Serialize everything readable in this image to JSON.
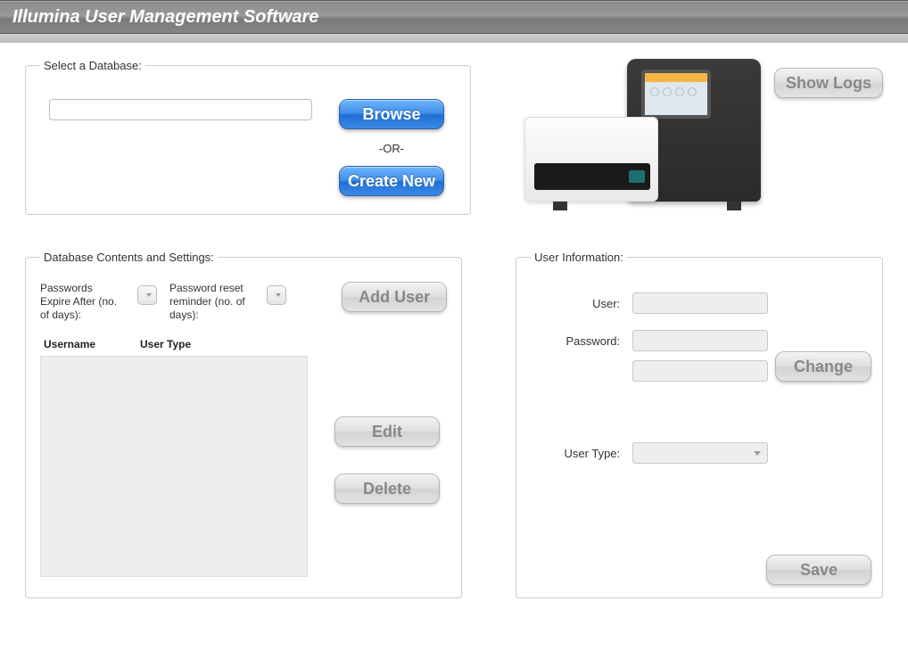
{
  "app": {
    "title": "Illumina User Management Software"
  },
  "selectDb": {
    "legend": "Select a Database:",
    "path": "",
    "browse": "Browse",
    "or": "-OR-",
    "createNew": "Create New"
  },
  "showLogs": "Show Logs",
  "contents": {
    "legend": "Database Contents and Settings:",
    "pwdExpireLabel": "Passwords Expire After (no. of days):",
    "pwdReminderLabel": "Password reset reminder (no. of days):",
    "addUser": "Add User",
    "columns": {
      "username": "Username",
      "usertype": "User Type"
    },
    "edit": "Edit",
    "delete": "Delete"
  },
  "userInfo": {
    "legend": "User Information:",
    "userLabel": "User:",
    "passwordLabel": "Password:",
    "userTypeLabel": "User Type:",
    "change": "Change",
    "save": "Save"
  }
}
